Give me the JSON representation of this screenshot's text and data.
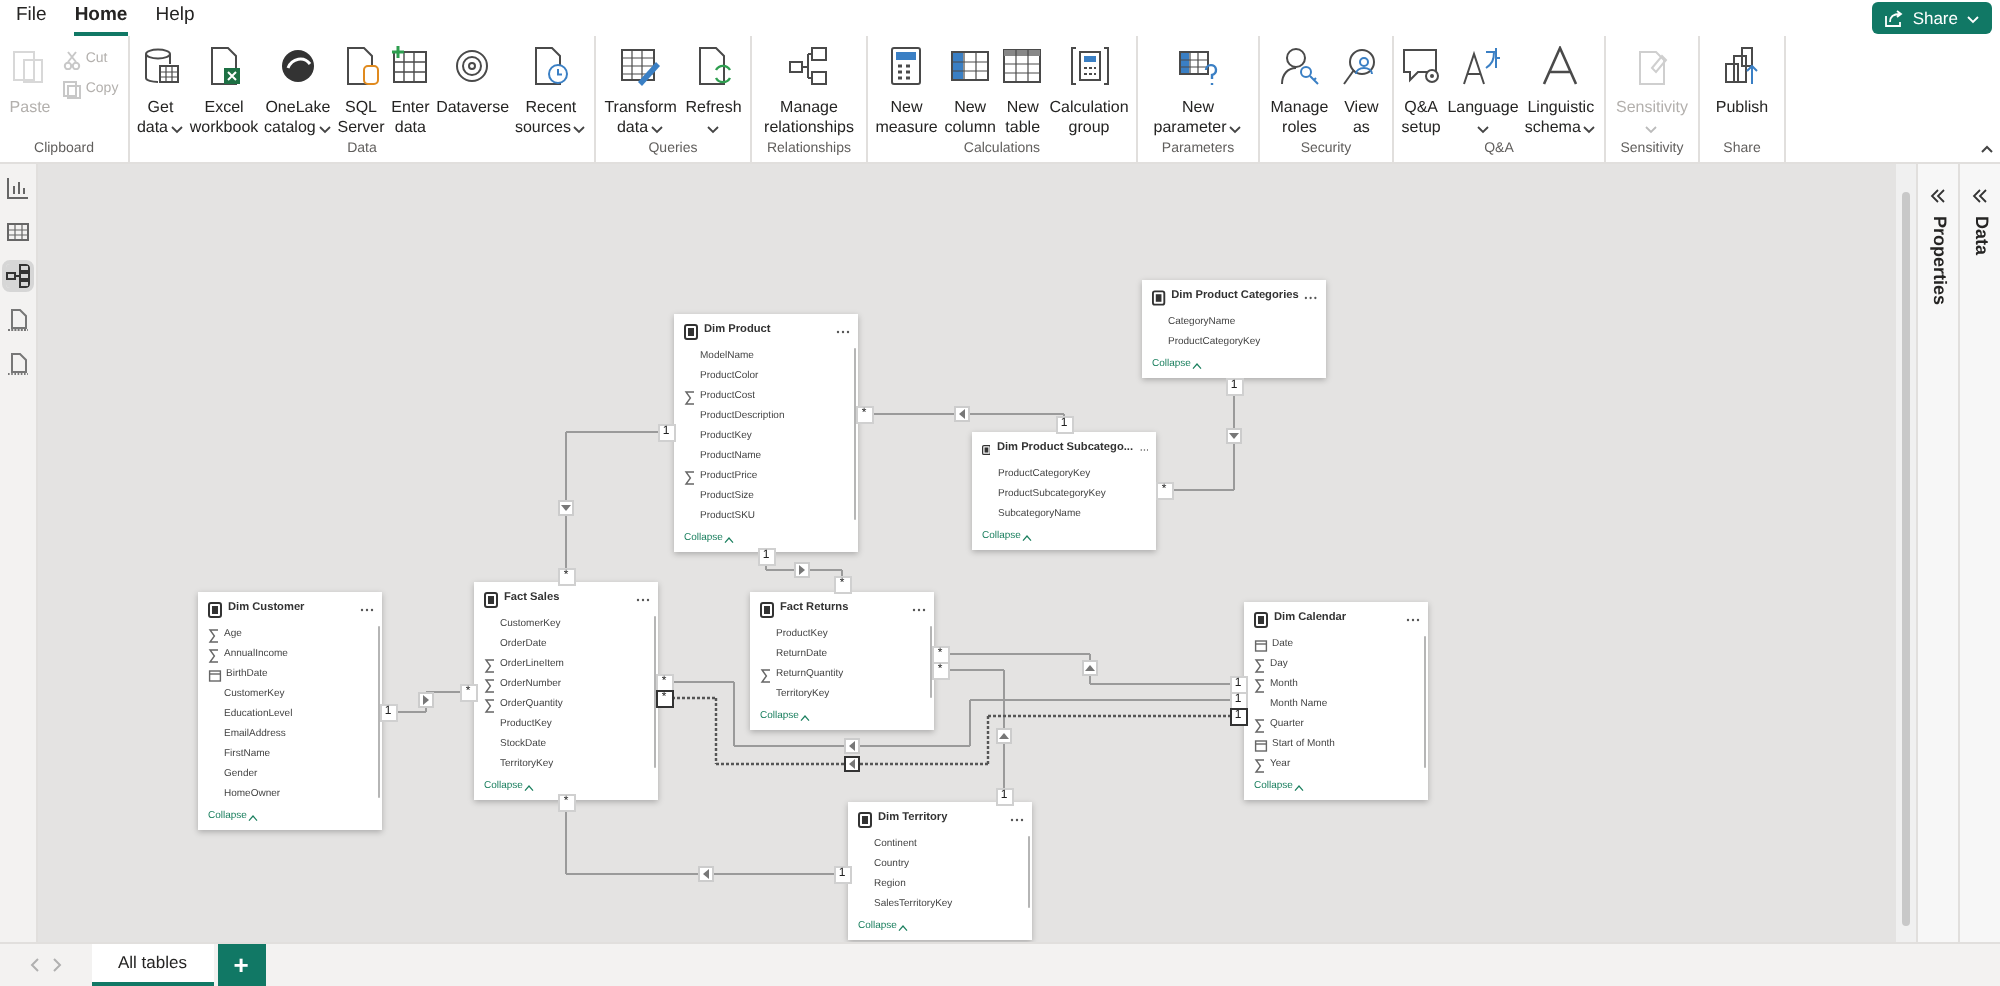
{
  "menu": [
    {
      "label": "File",
      "selected": false
    },
    {
      "label": "Home",
      "selected": true
    },
    {
      "label": "Help",
      "selected": false
    }
  ],
  "share_button": {
    "label": "Share"
  },
  "ribbon": [
    {
      "label": "Clipboard",
      "buttons": [
        {
          "label": "Paste",
          "kind": "large",
          "dropdown": false,
          "disabled": true
        },
        {
          "label": "Cut",
          "kind": "small",
          "disabled": true
        },
        {
          "label": "Copy",
          "kind": "small",
          "disabled": true
        }
      ]
    },
    {
      "label": "Data",
      "buttons": [
        {
          "label": "Get\ndata",
          "dropdown": true,
          "disabled": false
        },
        {
          "label": "Excel\nworkbook",
          "dropdown": false,
          "disabled": false
        },
        {
          "label": "OneLake\ncatalog",
          "dropdown": true,
          "disabled": false
        },
        {
          "label": "SQL\nServer",
          "dropdown": false,
          "disabled": false
        },
        {
          "label": "Enter\ndata",
          "dropdown": false,
          "disabled": false
        },
        {
          "label": "Dataverse",
          "dropdown": false,
          "disabled": false
        },
        {
          "label": "Recent\nsources",
          "dropdown": true,
          "disabled": false
        }
      ]
    },
    {
      "label": "Queries",
      "buttons": [
        {
          "label": "Transform\ndata",
          "dropdown": true,
          "disabled": false
        },
        {
          "label": "Refresh",
          "dropdown": true,
          "disabled": false
        }
      ]
    },
    {
      "label": "Relationships",
      "buttons": [
        {
          "label": "Manage\nrelationships",
          "dropdown": false,
          "disabled": false
        }
      ]
    },
    {
      "label": "Calculations",
      "buttons": [
        {
          "label": "New\nmeasure",
          "dropdown": false,
          "disabled": false
        },
        {
          "label": "New\ncolumn",
          "dropdown": false,
          "disabled": false
        },
        {
          "label": "New\ntable",
          "dropdown": false,
          "disabled": false
        },
        {
          "label": "Calculation\ngroup",
          "dropdown": false,
          "disabled": false
        }
      ]
    },
    {
      "label": "Parameters",
      "buttons": [
        {
          "label": "New\nparameter",
          "dropdown": true,
          "disabled": false
        }
      ]
    },
    {
      "label": "Security",
      "buttons": [
        {
          "label": "Manage\nroles",
          "dropdown": false,
          "disabled": false
        },
        {
          "label": "View\nas",
          "dropdown": false,
          "disabled": false
        }
      ]
    },
    {
      "label": "Q&A",
      "buttons": [
        {
          "label": "Q&A\nsetup",
          "dropdown": false,
          "disabled": false
        },
        {
          "label": "Language",
          "dropdown": true,
          "disabled": false
        },
        {
          "label": "Linguistic\nschema",
          "dropdown": true,
          "disabled": false
        }
      ]
    },
    {
      "label": "Sensitivity",
      "buttons": [
        {
          "label": "Sensitivity",
          "dropdown": true,
          "disabled": true
        }
      ]
    },
    {
      "label": "Share",
      "buttons": [
        {
          "label": "Publish",
          "dropdown": false,
          "disabled": false
        }
      ]
    }
  ],
  "view_rail": [
    {
      "selected": false
    },
    {
      "selected": false
    },
    {
      "selected": true
    },
    {
      "selected": false
    },
    {
      "selected": false
    }
  ],
  "canvas": {
    "tables": [
      {
        "name": "Dim Product",
        "fields": [
          {
            "name": "ModelName",
            "kind": "text"
          },
          {
            "name": "ProductColor",
            "kind": "text"
          },
          {
            "name": "ProductCost",
            "kind": "sum"
          },
          {
            "name": "ProductDescription",
            "kind": "text"
          },
          {
            "name": "ProductKey",
            "kind": "text"
          },
          {
            "name": "ProductName",
            "kind": "text"
          },
          {
            "name": "ProductPrice",
            "kind": "sum"
          },
          {
            "name": "ProductSize",
            "kind": "text"
          },
          {
            "name": "ProductSKU",
            "kind": "text"
          }
        ],
        "collapse": "Collapse"
      },
      {
        "name": "Dim Product Categories",
        "fields": [
          {
            "name": "CategoryName",
            "kind": "text"
          },
          {
            "name": "ProductCategoryKey",
            "kind": "text"
          }
        ],
        "collapse": "Collapse"
      },
      {
        "name": "Dim Product Subcatego...",
        "fields": [
          {
            "name": "ProductCategoryKey",
            "kind": "text"
          },
          {
            "name": "ProductSubcategoryKey",
            "kind": "text"
          },
          {
            "name": "SubcategoryName",
            "kind": "text"
          }
        ],
        "collapse": "Collapse"
      },
      {
        "name": "Dim Customer",
        "fields": [
          {
            "name": "Age",
            "kind": "sum"
          },
          {
            "name": "AnnualIncome",
            "kind": "sum"
          },
          {
            "name": "BirthDate",
            "kind": "date"
          },
          {
            "name": "CustomerKey",
            "kind": "text"
          },
          {
            "name": "EducationLevel",
            "kind": "text"
          },
          {
            "name": "EmailAddress",
            "kind": "text"
          },
          {
            "name": "FirstName",
            "kind": "text"
          },
          {
            "name": "Gender",
            "kind": "text"
          },
          {
            "name": "HomeOwner",
            "kind": "text"
          }
        ],
        "collapse": "Collapse"
      },
      {
        "name": "Fact Sales",
        "fields": [
          {
            "name": "CustomerKey",
            "kind": "text"
          },
          {
            "name": "OrderDate",
            "kind": "text"
          },
          {
            "name": "OrderLineItem",
            "kind": "sum"
          },
          {
            "name": "OrderNumber",
            "kind": "sum"
          },
          {
            "name": "OrderQuantity",
            "kind": "sum"
          },
          {
            "name": "ProductKey",
            "kind": "text"
          },
          {
            "name": "StockDate",
            "kind": "text"
          },
          {
            "name": "TerritoryKey",
            "kind": "text"
          }
        ],
        "collapse": "Collapse"
      },
      {
        "name": "Fact Returns",
        "fields": [
          {
            "name": "ProductKey",
            "kind": "text"
          },
          {
            "name": "ReturnDate",
            "kind": "text"
          },
          {
            "name": "ReturnQuantity",
            "kind": "sum"
          },
          {
            "name": "TerritoryKey",
            "kind": "text"
          }
        ],
        "collapse": "Collapse"
      },
      {
        "name": "Dim Calendar",
        "fields": [
          {
            "name": "Date",
            "kind": "date"
          },
          {
            "name": "Day",
            "kind": "sum"
          },
          {
            "name": "Month",
            "kind": "sum"
          },
          {
            "name": "Month Name",
            "kind": "text"
          },
          {
            "name": "Quarter",
            "kind": "sum"
          },
          {
            "name": "Start of Month",
            "kind": "date"
          },
          {
            "name": "Year",
            "kind": "sum"
          }
        ],
        "collapse": "Collapse"
      },
      {
        "name": "Dim Territory",
        "fields": [
          {
            "name": "Continent",
            "kind": "text"
          },
          {
            "name": "Country",
            "kind": "text"
          },
          {
            "name": "Region",
            "kind": "text"
          },
          {
            "name": "SalesTerritoryKey",
            "kind": "text"
          }
        ],
        "collapse": "Collapse"
      }
    ],
    "relationships": [
      {
        "from_label": "*",
        "to_label": "1",
        "active": true
      },
      {
        "from_label": "*",
        "to_label": "1",
        "active": true
      },
      {
        "from_label": "*",
        "to_label": "1",
        "active": true
      },
      {
        "from_label": "*",
        "to_label": "1",
        "active": true
      },
      {
        "from_label": "*",
        "to_label": "1",
        "active": true
      },
      {
        "from_label": "*",
        "to_label": "1",
        "active": true
      },
      {
        "from_label": "*",
        "to_label": "1",
        "active": true
      },
      {
        "from_label": "*",
        "to_label": "1",
        "active": true
      },
      {
        "from_label": "*",
        "to_label": "1",
        "active": true
      },
      {
        "from_label": "*",
        "to_label": "1",
        "active": false
      }
    ]
  },
  "panes": [
    {
      "label": "Properties"
    },
    {
      "label": "Data"
    }
  ],
  "page_tabs": [
    {
      "label": "All tables",
      "selected": true
    }
  ],
  "add_tab": {
    "label": "+"
  }
}
